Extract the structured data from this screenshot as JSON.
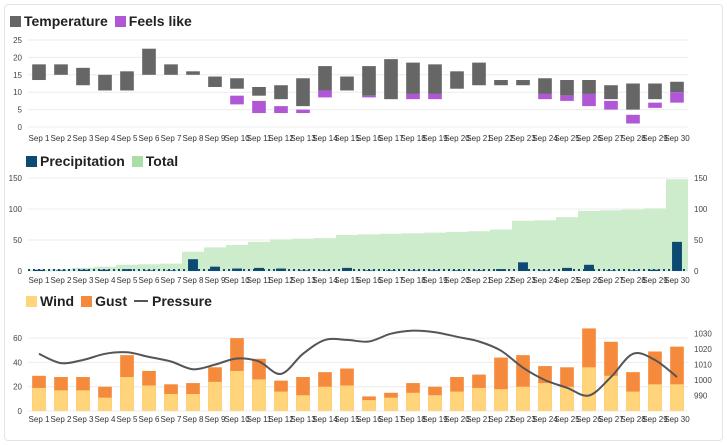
{
  "chart_data": [
    {
      "type": "bar",
      "subtype": "floating-range",
      "categories": [
        "Sep 1",
        "Sep 2",
        "Sep 3",
        "Sep 4",
        "Sep 5",
        "Sep 6",
        "Sep 7",
        "Sep 8",
        "Sep 9",
        "Sep 10",
        "Sep 11",
        "Sep 12",
        "Sep 13",
        "Sep 14",
        "Sep 15",
        "Sep 16",
        "Sep 17",
        "Sep 18",
        "Sep 19",
        "Sep 20",
        "Sep 21",
        "Sep 22",
        "Sep 23",
        "Sep 24",
        "Sep 25",
        "Sep 26",
        "Sep 27",
        "Sep 28",
        "Sep 29",
        "Sep 30"
      ],
      "series": [
        {
          "name": "Temperature",
          "color": "#666666",
          "low": [
            13.5,
            15,
            12,
            10.5,
            10.5,
            15,
            15,
            15,
            11.5,
            11,
            9,
            8,
            6,
            10.5,
            10.5,
            9,
            8,
            9.5,
            9.5,
            11,
            12,
            12,
            12,
            9.5,
            9,
            9.5,
            8,
            5,
            8,
            10
          ],
          "high": [
            18,
            18,
            17,
            15,
            16,
            22.5,
            18,
            16,
            14.5,
            14,
            11.5,
            12,
            14,
            17.5,
            14.5,
            17.5,
            19.5,
            18.5,
            18,
            16,
            18.5,
            13.5,
            13.5,
            14,
            13.5,
            13.5,
            12,
            12.5,
            12.5,
            13
          ]
        },
        {
          "name": "Feels like",
          "color": "#b057d6",
          "low": [
            null,
            null,
            null,
            null,
            null,
            null,
            null,
            null,
            null,
            6.5,
            4,
            4,
            4,
            8.5,
            null,
            8.5,
            null,
            8,
            8,
            null,
            null,
            null,
            null,
            8,
            7.5,
            6,
            5,
            1,
            5.5,
            7
          ],
          "high": [
            null,
            null,
            null,
            null,
            null,
            null,
            null,
            null,
            null,
            9,
            7.5,
            6,
            5,
            10.5,
            null,
            9,
            null,
            9.5,
            9.5,
            null,
            null,
            null,
            null,
            9.5,
            9,
            9.5,
            7.5,
            3.5,
            7,
            10
          ]
        }
      ],
      "ylim": [
        0,
        25
      ],
      "yticks": [
        "0",
        "5",
        "10",
        "15",
        "20",
        "25"
      ],
      "legend": "top-left"
    },
    {
      "type": "bar-area",
      "categories": [
        "Sep 1",
        "Sep 2",
        "Sep 3",
        "Sep 4",
        "Sep 5",
        "Sep 6",
        "Sep 7",
        "Sep 8",
        "Sep 9",
        "Sep 10",
        "Sep 11",
        "Sep 12",
        "Sep 13",
        "Sep 14",
        "Sep 15",
        "Sep 16",
        "Sep 17",
        "Sep 18",
        "Sep 19",
        "Sep 20",
        "Sep 21",
        "Sep 22",
        "Sep 23",
        "Sep 24",
        "Sep 25",
        "Sep 26",
        "Sep 27",
        "Sep 28",
        "Sep 29",
        "Sep 30"
      ],
      "series": [
        {
          "name": "Precipitation",
          "type": "bar",
          "color": "#0d4a72",
          "values": [
            2,
            1,
            2,
            2,
            3,
            1,
            1,
            19,
            7,
            4,
            5,
            4,
            1,
            1,
            5,
            1,
            1,
            1,
            1,
            1,
            1,
            3,
            14,
            1,
            5,
            10,
            1,
            1,
            2,
            47
          ]
        },
        {
          "name": "Total",
          "type": "area",
          "color": "#cdeccb",
          "values": [
            2,
            3,
            5,
            7,
            10,
            11,
            12,
            31,
            38,
            42,
            47,
            51,
            52,
            53,
            58,
            59,
            60,
            61,
            62,
            63,
            64,
            67,
            81,
            82,
            87,
            97,
            98,
            99,
            101,
            148
          ]
        }
      ],
      "ylim": [
        0,
        150
      ],
      "yticks": [
        "0",
        "50",
        "100",
        "150"
      ],
      "legend": "top-left"
    },
    {
      "type": "bar-line",
      "categories": [
        "Sep 1",
        "Sep 2",
        "Sep 3",
        "Sep 4",
        "Sep 5",
        "Sep 6",
        "Sep 7",
        "Sep 8",
        "Sep 9",
        "Sep 10",
        "Sep 11",
        "Sep 12",
        "Sep 13",
        "Sep 14",
        "Sep 15",
        "Sep 16",
        "Sep 17",
        "Sep 18",
        "Sep 19",
        "Sep 20",
        "Sep 21",
        "Sep 22",
        "Sep 23",
        "Sep 24",
        "Sep 25",
        "Sep 26",
        "Sep 27",
        "Sep 28",
        "Sep 29",
        "Sep 30"
      ],
      "series": [
        {
          "name": "Wind",
          "type": "bar",
          "color": "#ffd47a",
          "values": [
            19,
            17,
            17,
            11,
            28,
            21,
            14,
            14,
            24,
            33,
            26,
            16,
            13,
            20,
            21,
            9,
            11,
            15,
            13,
            16,
            19,
            18,
            20,
            23,
            20,
            36,
            29,
            16,
            22,
            22
          ]
        },
        {
          "name": "Gust",
          "type": "bar",
          "color": "#f58a3c",
          "values": [
            29,
            28,
            28,
            20,
            46,
            33,
            22,
            23,
            36,
            60,
            43,
            25,
            28,
            32,
            35,
            12,
            15,
            23,
            20,
            28,
            30,
            44,
            46,
            37,
            36,
            68,
            57,
            32,
            49,
            53
          ]
        },
        {
          "name": "Pressure",
          "type": "line",
          "color": "#555555",
          "axis": "right",
          "values": [
            1017,
            1011,
            1013,
            1017,
            1018,
            1015,
            1012,
            1007,
            1010,
            1014,
            1012,
            1004,
            1017,
            1026,
            1026,
            1025,
            1030,
            1032,
            1031,
            1028,
            1025,
            1019,
            1008,
            1000,
            995,
            990,
            1002,
            1017,
            1013,
            1002
          ]
        }
      ],
      "ylim": [
        0,
        70
      ],
      "yticks": [
        "0",
        "20",
        "40",
        "60"
      ],
      "y2lim": [
        980,
        1035
      ],
      "y2ticks": [
        "990",
        "1000",
        "1010",
        "1020",
        "1030"
      ],
      "legend": "top-left"
    }
  ],
  "panels": [
    {
      "legend": [
        {
          "label": "Temperature",
          "color": "#666666",
          "kind": "box"
        },
        {
          "label": "Feels like",
          "color": "#b057d6",
          "kind": "box"
        }
      ]
    },
    {
      "legend": [
        {
          "label": "Precipitation",
          "color": "#0d4a72",
          "kind": "box"
        },
        {
          "label": "Total",
          "color": "#a9dfa6",
          "kind": "box"
        }
      ]
    },
    {
      "legend": [
        {
          "label": "Wind",
          "color": "#ffd47a",
          "kind": "box"
        },
        {
          "label": "Gust",
          "color": "#f58a3c",
          "kind": "box"
        },
        {
          "label": "Pressure",
          "color": "#555555",
          "kind": "line"
        }
      ]
    }
  ]
}
